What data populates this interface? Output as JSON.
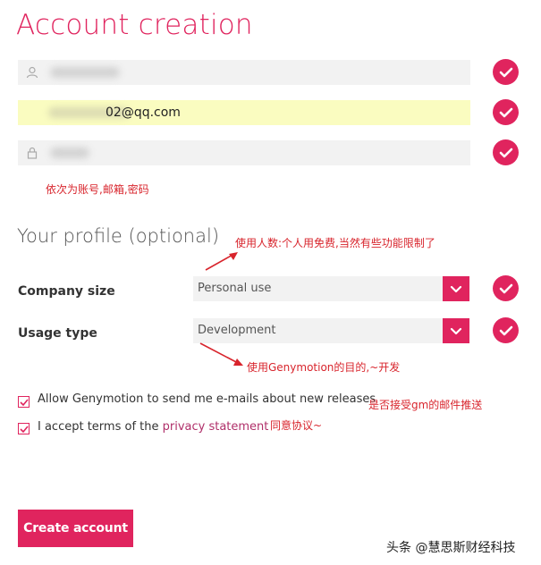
{
  "header": {
    "title": "Account creation"
  },
  "account": {
    "username": {
      "value": "",
      "icon": "user-icon"
    },
    "email": {
      "value": "02@qq.com"
    },
    "password": {
      "value": "",
      "icon": "lock-icon"
    }
  },
  "annotations": {
    "fields_note": "依次为账号,邮箱,密码",
    "company_note": "使用人数:个人用免费,当然有些功能限制了",
    "usage_note": "使用Genymotion的目的,~开发",
    "newsletter_note": "是否接受gm的邮件推送",
    "terms_note": "同意协议~"
  },
  "profile": {
    "title": "Your profile (optional)",
    "company_size_label": "Company size",
    "company_size_value": "Personal use",
    "usage_type_label": "Usage type",
    "usage_type_value": "Development"
  },
  "options": {
    "newsletter_label": "Allow Genymotion to send me e-mails about new releases",
    "terms_prefix": "I accept terms of the ",
    "terms_link": "privacy statement",
    "newsletter_checked": true,
    "terms_checked": true
  },
  "actions": {
    "create_label": "Create account"
  },
  "watermark": "头条 @慧思斯财经科技",
  "colors": {
    "accent": "#e0245e",
    "annotation": "#d8242c",
    "highlight": "#fafcc0"
  }
}
